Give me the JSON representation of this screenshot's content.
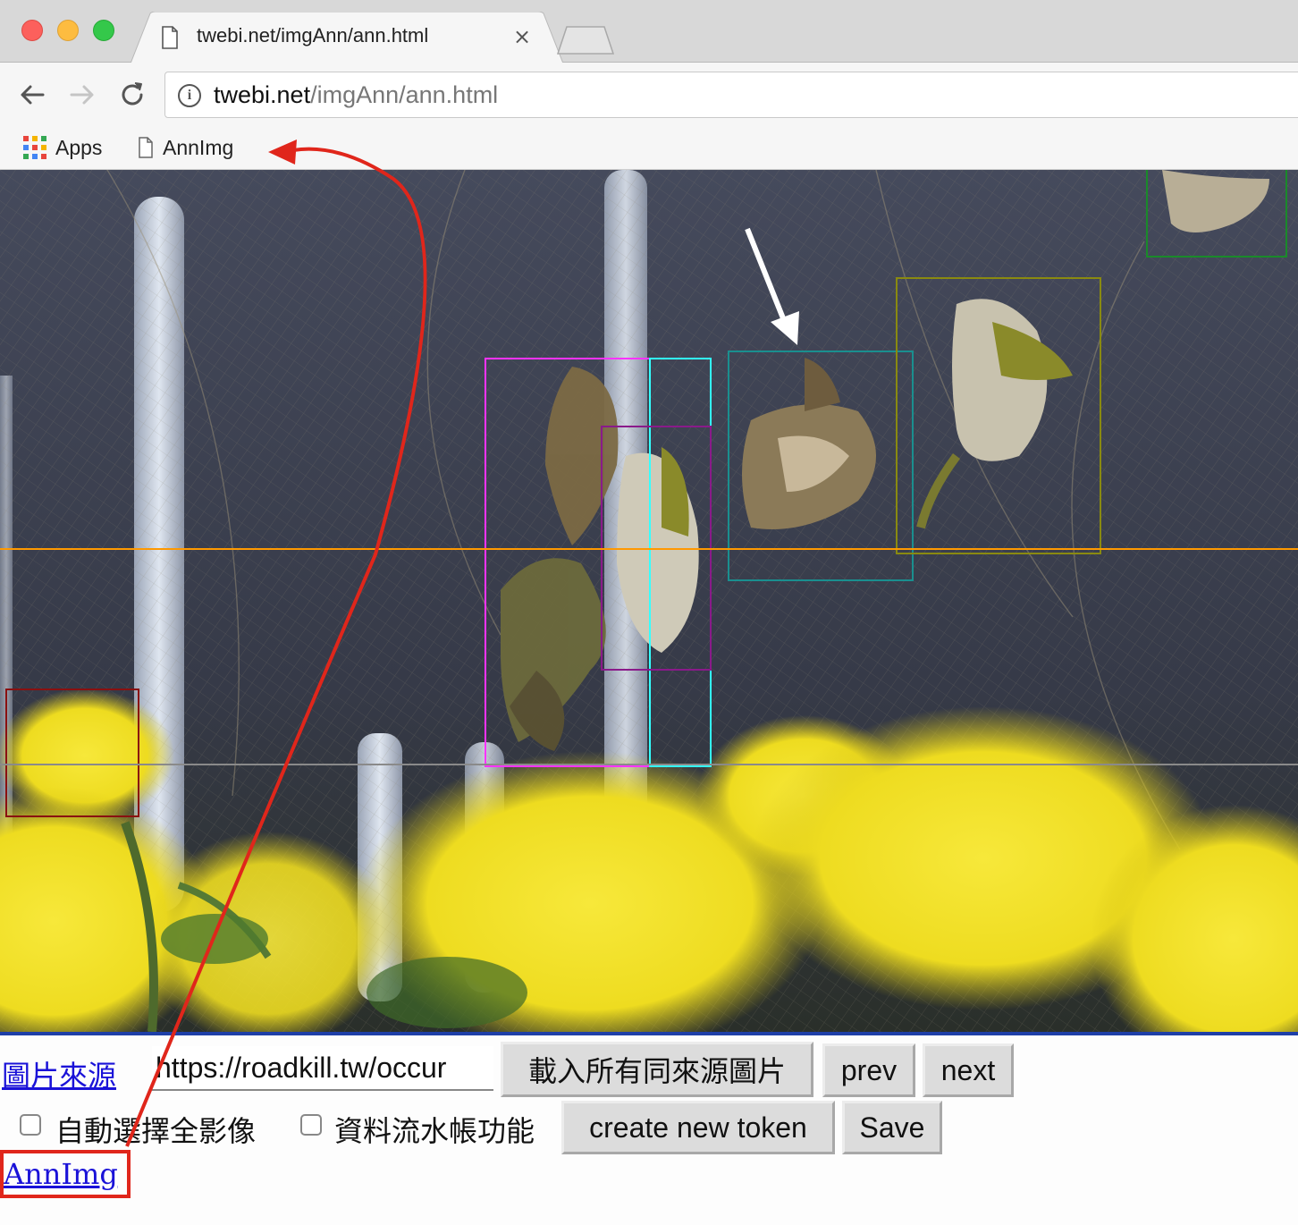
{
  "browser": {
    "tab_title": "twebi.net/imgAnn/ann.html",
    "tab_close": "×",
    "url_host": "twebi.net",
    "url_path": "/imgAnn/ann.html"
  },
  "bookmarks": {
    "items": [
      {
        "label": "Apps",
        "icon": "apps-grid-icon"
      },
      {
        "label": "AnnImg",
        "icon": "page-icon"
      }
    ]
  },
  "annotations": {
    "boxes": [
      {
        "name": "bbox-magenta",
        "color": "#ff33ff"
      },
      {
        "name": "bbox-cyan",
        "color": "#33ffff"
      },
      {
        "name": "bbox-purple",
        "color": "#8a1a8a"
      },
      {
        "name": "bbox-teal",
        "color": "#1a8f8f"
      },
      {
        "name": "bbox-olive",
        "color": "#8a8a10"
      },
      {
        "name": "bbox-green",
        "color": "#1a8a2a"
      },
      {
        "name": "bbox-darkred",
        "color": "#8a1010"
      }
    ],
    "guide_colors": {
      "orange": "#ff9900",
      "gray": "#8a8a8a"
    }
  },
  "controls": {
    "source_link": "圖片來源",
    "source_url_value": "https://roadkill.tw/occur",
    "load_all_button": "載入所有同來源圖片",
    "prev_button": "prev",
    "next_button": "next",
    "auto_select_label": "自動選擇全影像",
    "flow_account_label": "資料流水帳功能",
    "create_token_button": "create new token",
    "save_button": "Save",
    "annimg_link": "AnnImg"
  },
  "colors": {
    "link": "#1a12d8",
    "highlight": "#e0261b"
  }
}
